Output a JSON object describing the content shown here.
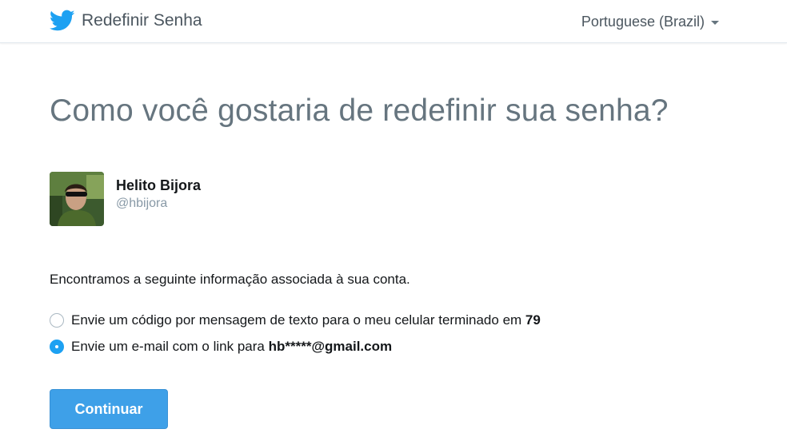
{
  "header": {
    "title": "Redefinir Senha",
    "language": "Portuguese (Brazil)"
  },
  "main": {
    "heading": "Como você gostaria de redefinir sua senha?",
    "account": {
      "name": "Helito Bijora",
      "handle": "@hbijora"
    },
    "info_text": "Encontramos a seguinte informação associada à sua conta.",
    "options": [
      {
        "label": "Envie um código por mensagem de texto para o meu celular terminado em ",
        "value": "79",
        "checked": false
      },
      {
        "label": "Envie um e-mail com o link para ",
        "value": "hb*****@gmail.com",
        "checked": true
      }
    ],
    "continue_label": "Continuar"
  },
  "colors": {
    "brand_blue": "#1da1f2",
    "button_blue": "#3ea0e8",
    "heading_gray": "#66757f"
  },
  "icons": {
    "brand": "twitter-bird-icon",
    "dropdown": "caret-down-icon",
    "radio_unchecked": "radio-unchecked-icon",
    "radio_checked": "radio-checked-icon"
  }
}
